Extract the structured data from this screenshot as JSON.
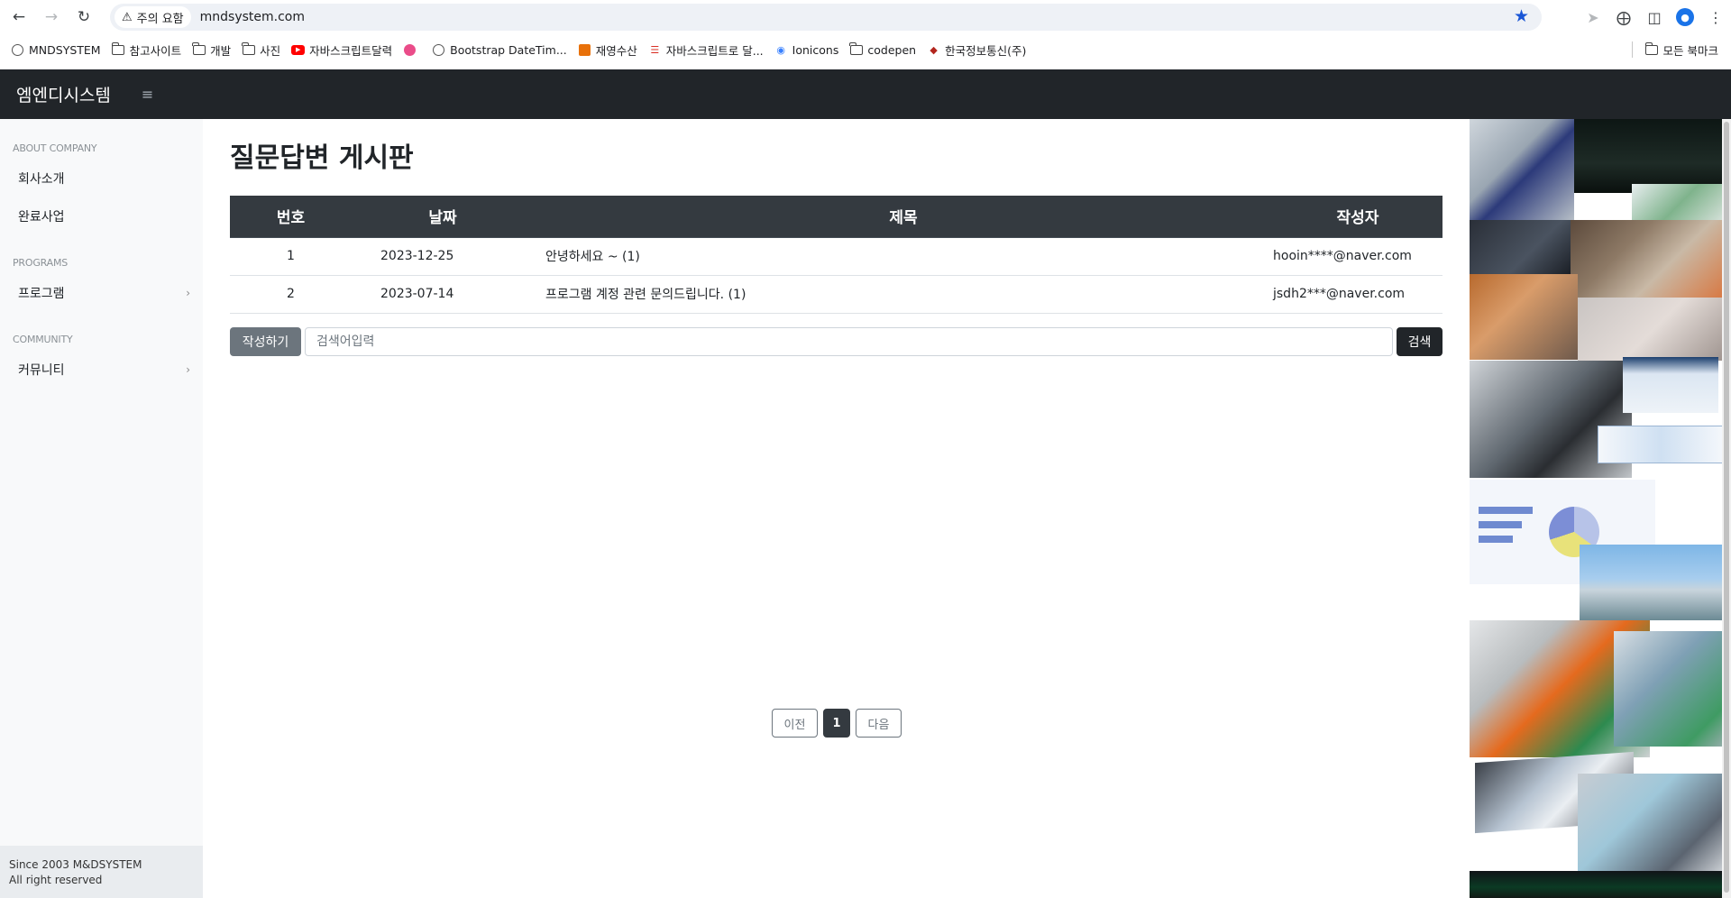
{
  "browser": {
    "security_label": "주의 요함",
    "url": "mndsystem.com",
    "bookmarks": [
      {
        "label": "MNDSYSTEM",
        "icon": "globe-icon"
      },
      {
        "label": "참고사이트",
        "icon": "folder-icon"
      },
      {
        "label": "개발",
        "icon": "folder-icon"
      },
      {
        "label": "사진",
        "icon": "folder-icon"
      },
      {
        "label": "자바스크립트달력",
        "icon": "youtube-icon"
      },
      {
        "label": "",
        "icon": "dribbble-icon"
      },
      {
        "label": "Bootstrap DateTim...",
        "icon": "globe-icon"
      },
      {
        "label": "재영수산",
        "icon": "site-icon"
      },
      {
        "label": "자바스크립트로 달...",
        "icon": "site-icon"
      },
      {
        "label": "Ionicons",
        "icon": "ionicons-icon"
      },
      {
        "label": "codepen",
        "icon": "folder-icon"
      },
      {
        "label": "한국정보통신(주)",
        "icon": "site-icon"
      }
    ],
    "all_bookmarks_label": "모든 북마크"
  },
  "header": {
    "brand": "엠엔디시스템",
    "menu_icon": "hamburger-icon"
  },
  "sidebar": {
    "sections": [
      {
        "heading": "ABOUT COMPANY",
        "items": [
          {
            "label": "회사소개",
            "chevron": false
          },
          {
            "label": "완료사업",
            "chevron": false
          }
        ]
      },
      {
        "heading": "PROGRAMS",
        "items": [
          {
            "label": "프로그램",
            "chevron": true
          }
        ]
      },
      {
        "heading": "COMMUNITY",
        "items": [
          {
            "label": "커뮤니티",
            "chevron": true
          }
        ]
      }
    ],
    "footer_line1": "Since 2003 M&DSYSTEM",
    "footer_line2": "All right reserved"
  },
  "main": {
    "title": "질문답변 게시판",
    "columns": [
      "번호",
      "날짜",
      "제목",
      "작성자"
    ],
    "rows": [
      {
        "no": "1",
        "date": "2023-12-25",
        "title": "안녕하세요 ~ (1)",
        "author": "hooin****@naver.com"
      },
      {
        "no": "2",
        "date": "2023-07-14",
        "title": "프로그램 계정 관련 문의드립니다. (1)",
        "author": "jsdh2***@naver.com"
      }
    ],
    "write_button": "작성하기",
    "search_placeholder": "검색어입력",
    "search_button": "검색",
    "pagination": {
      "prev": "이전",
      "current": "1",
      "next": "다음"
    }
  },
  "colors": {
    "navbar": "#212529",
    "table_header": "#343a40",
    "sidebar": "#f8f9fa",
    "secondary_button": "#6c757d"
  }
}
